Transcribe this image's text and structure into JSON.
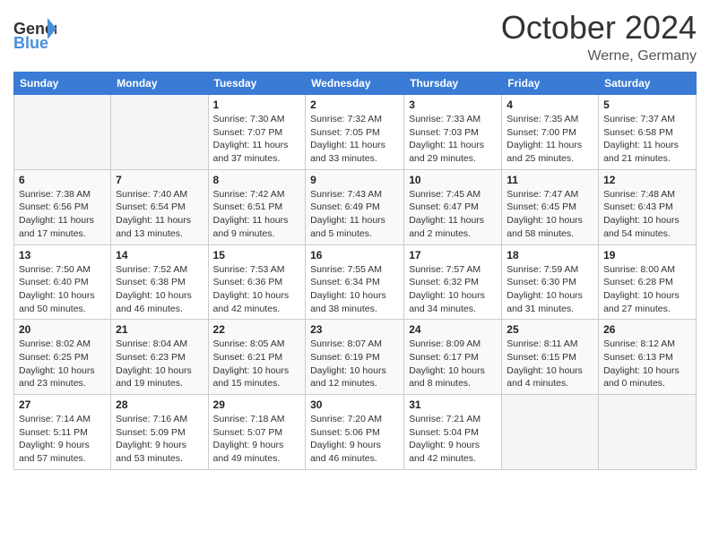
{
  "header": {
    "logo_text_general": "General",
    "logo_text_blue": "Blue",
    "month_title": "October 2024",
    "location": "Werne, Germany"
  },
  "weekdays": [
    "Sunday",
    "Monday",
    "Tuesday",
    "Wednesday",
    "Thursday",
    "Friday",
    "Saturday"
  ],
  "weeks": [
    [
      {
        "day": "",
        "info": ""
      },
      {
        "day": "",
        "info": ""
      },
      {
        "day": "1",
        "info": "Sunrise: 7:30 AM\nSunset: 7:07 PM\nDaylight: 11 hours and 37 minutes."
      },
      {
        "day": "2",
        "info": "Sunrise: 7:32 AM\nSunset: 7:05 PM\nDaylight: 11 hours and 33 minutes."
      },
      {
        "day": "3",
        "info": "Sunrise: 7:33 AM\nSunset: 7:03 PM\nDaylight: 11 hours and 29 minutes."
      },
      {
        "day": "4",
        "info": "Sunrise: 7:35 AM\nSunset: 7:00 PM\nDaylight: 11 hours and 25 minutes."
      },
      {
        "day": "5",
        "info": "Sunrise: 7:37 AM\nSunset: 6:58 PM\nDaylight: 11 hours and 21 minutes."
      }
    ],
    [
      {
        "day": "6",
        "info": "Sunrise: 7:38 AM\nSunset: 6:56 PM\nDaylight: 11 hours and 17 minutes."
      },
      {
        "day": "7",
        "info": "Sunrise: 7:40 AM\nSunset: 6:54 PM\nDaylight: 11 hours and 13 minutes."
      },
      {
        "day": "8",
        "info": "Sunrise: 7:42 AM\nSunset: 6:51 PM\nDaylight: 11 hours and 9 minutes."
      },
      {
        "day": "9",
        "info": "Sunrise: 7:43 AM\nSunset: 6:49 PM\nDaylight: 11 hours and 5 minutes."
      },
      {
        "day": "10",
        "info": "Sunrise: 7:45 AM\nSunset: 6:47 PM\nDaylight: 11 hours and 2 minutes."
      },
      {
        "day": "11",
        "info": "Sunrise: 7:47 AM\nSunset: 6:45 PM\nDaylight: 10 hours and 58 minutes."
      },
      {
        "day": "12",
        "info": "Sunrise: 7:48 AM\nSunset: 6:43 PM\nDaylight: 10 hours and 54 minutes."
      }
    ],
    [
      {
        "day": "13",
        "info": "Sunrise: 7:50 AM\nSunset: 6:40 PM\nDaylight: 10 hours and 50 minutes."
      },
      {
        "day": "14",
        "info": "Sunrise: 7:52 AM\nSunset: 6:38 PM\nDaylight: 10 hours and 46 minutes."
      },
      {
        "day": "15",
        "info": "Sunrise: 7:53 AM\nSunset: 6:36 PM\nDaylight: 10 hours and 42 minutes."
      },
      {
        "day": "16",
        "info": "Sunrise: 7:55 AM\nSunset: 6:34 PM\nDaylight: 10 hours and 38 minutes."
      },
      {
        "day": "17",
        "info": "Sunrise: 7:57 AM\nSunset: 6:32 PM\nDaylight: 10 hours and 34 minutes."
      },
      {
        "day": "18",
        "info": "Sunrise: 7:59 AM\nSunset: 6:30 PM\nDaylight: 10 hours and 31 minutes."
      },
      {
        "day": "19",
        "info": "Sunrise: 8:00 AM\nSunset: 6:28 PM\nDaylight: 10 hours and 27 minutes."
      }
    ],
    [
      {
        "day": "20",
        "info": "Sunrise: 8:02 AM\nSunset: 6:25 PM\nDaylight: 10 hours and 23 minutes."
      },
      {
        "day": "21",
        "info": "Sunrise: 8:04 AM\nSunset: 6:23 PM\nDaylight: 10 hours and 19 minutes."
      },
      {
        "day": "22",
        "info": "Sunrise: 8:05 AM\nSunset: 6:21 PM\nDaylight: 10 hours and 15 minutes."
      },
      {
        "day": "23",
        "info": "Sunrise: 8:07 AM\nSunset: 6:19 PM\nDaylight: 10 hours and 12 minutes."
      },
      {
        "day": "24",
        "info": "Sunrise: 8:09 AM\nSunset: 6:17 PM\nDaylight: 10 hours and 8 minutes."
      },
      {
        "day": "25",
        "info": "Sunrise: 8:11 AM\nSunset: 6:15 PM\nDaylight: 10 hours and 4 minutes."
      },
      {
        "day": "26",
        "info": "Sunrise: 8:12 AM\nSunset: 6:13 PM\nDaylight: 10 hours and 0 minutes."
      }
    ],
    [
      {
        "day": "27",
        "info": "Sunrise: 7:14 AM\nSunset: 5:11 PM\nDaylight: 9 hours and 57 minutes."
      },
      {
        "day": "28",
        "info": "Sunrise: 7:16 AM\nSunset: 5:09 PM\nDaylight: 9 hours and 53 minutes."
      },
      {
        "day": "29",
        "info": "Sunrise: 7:18 AM\nSunset: 5:07 PM\nDaylight: 9 hours and 49 minutes."
      },
      {
        "day": "30",
        "info": "Sunrise: 7:20 AM\nSunset: 5:06 PM\nDaylight: 9 hours and 46 minutes."
      },
      {
        "day": "31",
        "info": "Sunrise: 7:21 AM\nSunset: 5:04 PM\nDaylight: 9 hours and 42 minutes."
      },
      {
        "day": "",
        "info": ""
      },
      {
        "day": "",
        "info": ""
      }
    ]
  ]
}
